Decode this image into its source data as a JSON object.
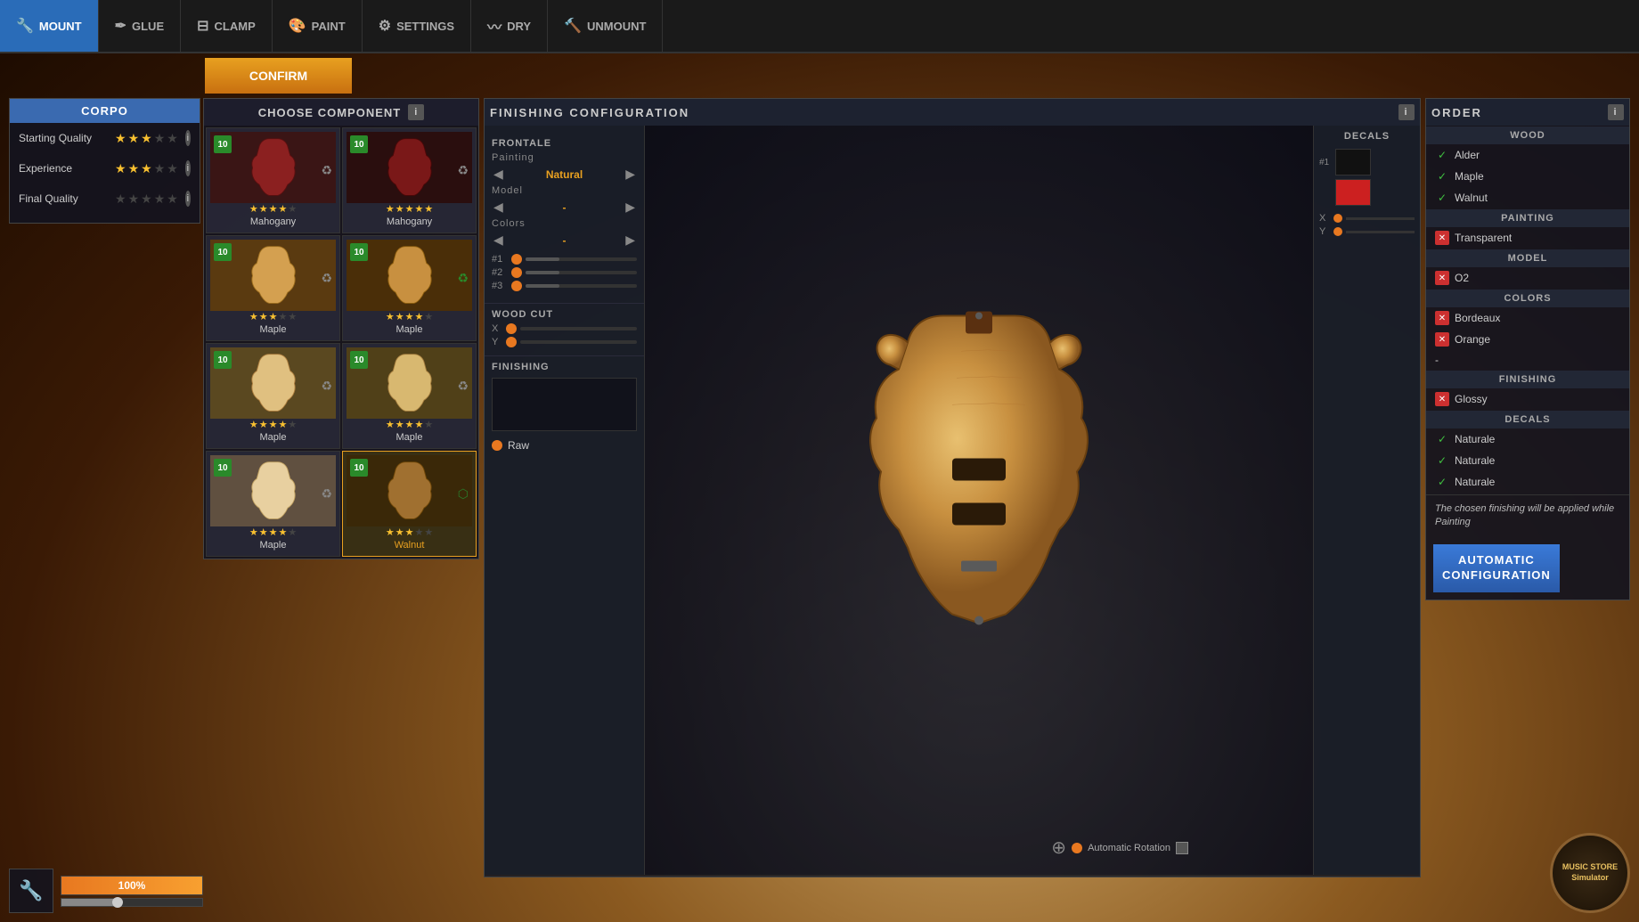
{
  "nav": {
    "items": [
      {
        "id": "mount",
        "label": "MOUNT",
        "icon": "🔧",
        "active": true
      },
      {
        "id": "glue",
        "label": "GLUE",
        "icon": "🖊",
        "active": false
      },
      {
        "id": "clamp",
        "label": "CLAMP",
        "icon": "🔩",
        "active": false
      },
      {
        "id": "paint",
        "label": "PAINT",
        "icon": "🎨",
        "active": false
      },
      {
        "id": "settings",
        "label": "SETTINGS",
        "icon": "⚙",
        "active": false
      },
      {
        "id": "dry",
        "label": "DRY",
        "icon": "〰",
        "active": false
      },
      {
        "id": "unmount",
        "label": "UNMOUNT",
        "icon": "🔨",
        "active": false
      }
    ],
    "confirm_label": "CONFIRM"
  },
  "left_panel": {
    "title": "CORPO",
    "stats": {
      "starting_quality_label": "Starting Quality",
      "experience_label": "Experience",
      "final_quality_label": "Final Quality"
    },
    "starting_quality_stars": 3,
    "experience_stars": 3,
    "final_quality_stars": 0,
    "total_stars": 5
  },
  "choose_component": {
    "title": "CHOOSE COMPONENT",
    "items": [
      {
        "name": "Mahogany",
        "stars": 4,
        "badge": "10",
        "selected": false,
        "color": "#8b2020"
      },
      {
        "name": "Mahogany",
        "stars": 5,
        "badge": "10",
        "selected": false,
        "color": "#7a1818"
      },
      {
        "name": "Maple",
        "stars": 3,
        "badge": "10",
        "selected": false,
        "color": "#d4a050"
      },
      {
        "name": "Maple",
        "stars": 4,
        "badge": "10",
        "selected": false,
        "color": "#c89040"
      },
      {
        "name": "Maple",
        "stars": 4,
        "badge": "10",
        "selected": false,
        "color": "#e0c080"
      },
      {
        "name": "Maple",
        "stars": 4,
        "badge": "10",
        "selected": false,
        "color": "#d8b870"
      },
      {
        "name": "Maple",
        "stars": 4,
        "badge": "10",
        "selected": false,
        "color": "#e8d0a0"
      },
      {
        "name": "Walnut",
        "stars": 3,
        "badge": "10",
        "selected": true,
        "color": "#a07030"
      }
    ]
  },
  "finishing_config": {
    "title": "FINISHING CONFIGURATION",
    "frontale_label": "FRONTALE",
    "painting_label": "Painting",
    "painting_value": "Natural",
    "model_label": "Model",
    "model_value": "-",
    "colors_label": "Colors",
    "colors_value": "-",
    "woodcut_label": "WOOD CUT",
    "finishing_label": "FINISHING",
    "finishing_value": "Raw",
    "color_slots": [
      "#1",
      "#2",
      "#3"
    ]
  },
  "decals": {
    "title": "DECALS",
    "slot_num": "#1",
    "swatch_black": true,
    "swatch_red": true,
    "x_label": "X",
    "y_label": "Y"
  },
  "order_panel": {
    "title": "ORDER",
    "wood_section": "WOOD",
    "painting_section": "PAINTING",
    "model_section": "MODEL",
    "colors_section": "COLORS",
    "finishing_section": "FINISHING",
    "decals_section": "DECALS",
    "wood_items": [
      {
        "label": "Alder",
        "check": "green"
      },
      {
        "label": "Maple",
        "check": "green"
      },
      {
        "label": "Walnut",
        "check": "green"
      }
    ],
    "painting_items": [
      {
        "label": "Transparent",
        "check": "red"
      }
    ],
    "model_items": [
      {
        "label": "O2",
        "check": "red"
      }
    ],
    "colors_items": [
      {
        "label": "Bordeaux",
        "check": "red"
      },
      {
        "label": "Orange",
        "check": "red"
      },
      {
        "label": "-",
        "check": "none"
      }
    ],
    "finishing_items": [
      {
        "label": "Glossy",
        "check": "red"
      }
    ],
    "decals_items": [
      {
        "label": "Naturale",
        "check": "green"
      },
      {
        "label": "Naturale",
        "check": "green"
      },
      {
        "label": "Naturale",
        "check": "green"
      }
    ],
    "finishing_note": "The chosen finishing will be applied while Painting",
    "auto_config_label": "AUTOMATIC\nCONFIGURATION"
  },
  "bottom_bar": {
    "progress_value": "100%",
    "logo_line1": "MUSIC STORE",
    "logo_line2": "Simulator"
  },
  "auto_rotation": {
    "label": "Automatic Rotation"
  }
}
